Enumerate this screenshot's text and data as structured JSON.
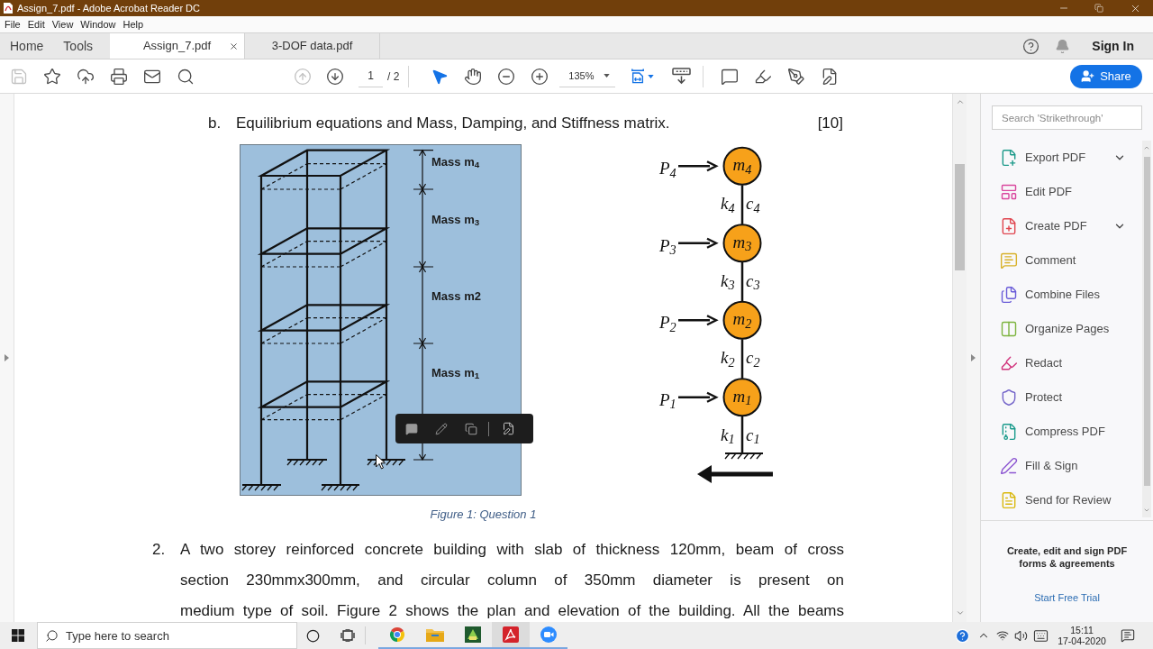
{
  "window": {
    "title": "Assign_7.pdf - Adobe Acrobat Reader DC"
  },
  "menu": [
    "File",
    "Edit",
    "View",
    "Window",
    "Help"
  ],
  "tabs": [
    {
      "label": "Home",
      "kind": "nav",
      "selected": false
    },
    {
      "label": "Tools",
      "kind": "nav",
      "selected": false
    },
    {
      "label": "Assign_7.pdf",
      "kind": "document",
      "selected": true
    },
    {
      "label": "3-DOF data.pdf",
      "kind": "document",
      "selected": false
    }
  ],
  "account": {
    "sign_in": "Sign In"
  },
  "toolbar": {
    "save": {
      "disabled": true
    },
    "previous_page": {
      "disabled": true
    },
    "next_page": {
      "disabled": false
    },
    "page": {
      "current": "1",
      "total": "/ 2"
    },
    "pointer_tools": [
      {
        "selected": true
      },
      {
        "selected": false
      }
    ],
    "zoom": "135%",
    "share": "Share"
  },
  "document": {
    "items": [
      {
        "marker": "b.",
        "text": "Equilibrium equations and Mass, Damping, and Stiffness matrix.",
        "marks": "[10]"
      }
    ],
    "building_figure": {
      "labels": [
        "Mass m$_{4}$",
        "Mass m$_{3}$",
        "Mass m2",
        "Mass m$_{1}$"
      ]
    },
    "model_figure": {
      "levels": [
        {
          "mass": "m$_{4}$",
          "force": "P$_{4}$",
          "stiffness": "k$_{4}$",
          "damping": "c$_{4}$"
        },
        {
          "mass": "m$_{3}$",
          "force": "P$_{3}$",
          "stiffness": "k$_{3}$",
          "damping": "c$_{3}$"
        },
        {
          "mass": "m$_{2}$",
          "force": "P$_{2}$",
          "stiffness": "k$_{2}$",
          "damping": "c$_{2}$"
        },
        {
          "mass": "m$_{1}$",
          "force": "P$_{1}$",
          "stiffness": "k$_{1}$",
          "damping": "c$_{1}$"
        }
      ]
    },
    "caption": "Figure 1: Question 1",
    "question": {
      "marker": "2.",
      "lines": [
        "A two storey reinforced concrete building with slab of thickness 120mm, beam of cross",
        "section 230mmx300mm, and circular column of 350mm diameter is present on",
        "medium type of soil. Figure 2 shows the plan and elevation of the building. All the beams"
      ]
    }
  },
  "tools_panel": {
    "search": {
      "placeholder": "Search 'Strikethrough'"
    },
    "items": [
      {
        "label": "Export PDF",
        "expandable": true
      },
      {
        "label": "Edit PDF",
        "expandable": false
      },
      {
        "label": "Create PDF",
        "expandable": true
      },
      {
        "label": "Comment",
        "expandable": false
      },
      {
        "label": "Combine Files",
        "expandable": false
      },
      {
        "label": "Organize Pages",
        "expandable": false
      },
      {
        "label": "Redact",
        "expandable": false
      },
      {
        "label": "Protect",
        "expandable": false
      },
      {
        "label": "Compress PDF",
        "expandable": false
      },
      {
        "label": "Fill & Sign",
        "expandable": false
      },
      {
        "label": "Send for Review",
        "expandable": false
      }
    ],
    "promo": {
      "text": "Create, edit and sign PDF forms & agreements",
      "link": "Start Free Trial"
    }
  },
  "taskbar": {
    "search": {
      "placeholder": "Type here to search"
    },
    "apps": [
      {
        "active": false
      },
      {
        "active": false
      },
      {
        "active": false
      },
      {
        "active": true
      },
      {
        "active": false
      }
    ],
    "time": "15:11",
    "date": "17-04-2020"
  }
}
